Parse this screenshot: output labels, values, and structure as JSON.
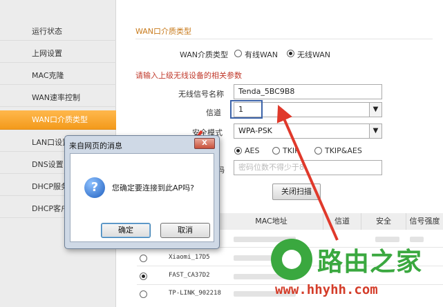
{
  "sidebar": {
    "items": [
      {
        "label": "运行状态"
      },
      {
        "label": "上网设置"
      },
      {
        "label": "MAC克隆"
      },
      {
        "label": "WAN速率控制"
      },
      {
        "label": "WAN口介质类型",
        "active": true
      },
      {
        "label": "LAN口设置"
      },
      {
        "label": "DNS设置"
      },
      {
        "label": "DHCP服务器"
      },
      {
        "label": "DHCP客户端"
      }
    ]
  },
  "main": {
    "section_title": "WAN口介质类型",
    "wan_media": {
      "label": "WAN介质类型",
      "options": [
        {
          "label": "有线WAN",
          "selected": false
        },
        {
          "label": "无线WAN",
          "selected": true
        }
      ]
    },
    "hint": "请输入上级无线设备的相关参数",
    "ssid": {
      "label": "无线信号名称",
      "value": "Tenda_5BC9B8"
    },
    "channel": {
      "label": "信道",
      "value": "1"
    },
    "security": {
      "label": "安全模式",
      "value": "WPA-PSK"
    },
    "encryption": {
      "options": [
        {
          "label": "AES",
          "selected": true
        },
        {
          "label": "TKIP",
          "selected": false
        },
        {
          "label": "TKIP&AES",
          "selected": false
        }
      ]
    },
    "password": {
      "label": "码",
      "placeholder": "密码位数不得少于8"
    },
    "close_scan_label": "关闭扫描",
    "table": {
      "headers": [
        "MAC地址",
        "信道",
        "安全",
        "信号强度"
      ],
      "rows": [
        {
          "ssid": "Xiaomi_17D5",
          "selected": false
        },
        {
          "ssid": "FAST_CA37D2",
          "selected": true
        },
        {
          "ssid": "TP-LINK_902218",
          "selected": false
        }
      ]
    }
  },
  "dialog": {
    "title": "来自网页的消息",
    "close_label": "X",
    "message": "您确定要连接到此AP吗?",
    "ok_label": "确定",
    "cancel_label": "取消"
  },
  "watermark": {
    "brand": "路由之家",
    "url": "www.hhyhh.com"
  },
  "colors": {
    "accent": "#f39a1b",
    "hint": "#c0392b",
    "arrow": "#e0392b",
    "highlight": "#3b62a8",
    "watermark_green": "#3aa83f",
    "watermark_red": "#d43d2a"
  }
}
